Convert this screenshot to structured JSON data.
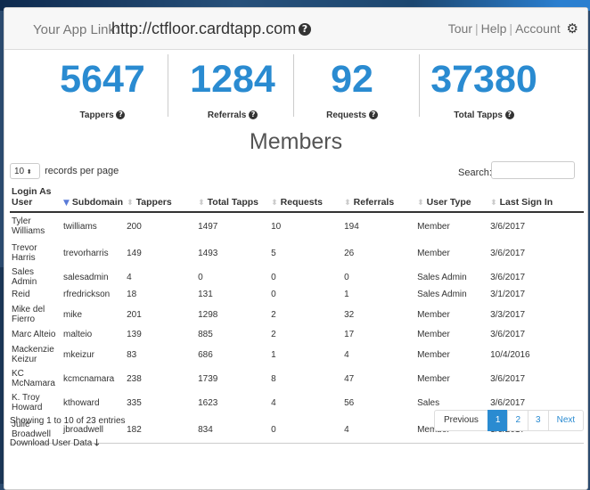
{
  "header": {
    "app_link_label": "Your App Link:",
    "app_link_url": "http://ctfloor.cardtapp.com",
    "nav": {
      "tour": "Tour",
      "help": "Help",
      "account": "Account"
    }
  },
  "stats": [
    {
      "value": "5647",
      "label": "Tappers"
    },
    {
      "value": "1284",
      "label": "Referrals"
    },
    {
      "value": "92",
      "label": "Requests"
    },
    {
      "value": "37380",
      "label": "Total Tapps"
    }
  ],
  "members_title": "Members",
  "controls": {
    "records_per_page_value": "10",
    "records_per_page_label": "records per page",
    "search_label": "Search:"
  },
  "table": {
    "columns": [
      "Login As User",
      "Subdomain",
      "Tappers",
      "Total Tapps",
      "Requests",
      "Referrals",
      "User Type",
      "Last Sign In"
    ],
    "rows": [
      [
        "Tyler Williams",
        "twilliams",
        "200",
        "1497",
        "10",
        "194",
        "Member",
        "3/6/2017"
      ],
      [
        "Trevor Harris",
        "trevorharris",
        "149",
        "1493",
        "5",
        "26",
        "Member",
        "3/6/2017"
      ],
      [
        "Sales Admin",
        "salesadmin",
        "4",
        "0",
        "0",
        "0",
        "Sales Admin",
        "3/6/2017"
      ],
      [
        "Reid",
        "rfredrickson",
        "18",
        "131",
        "0",
        "1",
        "Sales Admin",
        "3/1/2017"
      ],
      [
        "Mike del Fierro",
        "mike",
        "201",
        "1298",
        "2",
        "32",
        "Member",
        "3/3/2017"
      ],
      [
        "Marc Alteio",
        "malteio",
        "139",
        "885",
        "2",
        "17",
        "Member",
        "3/6/2017"
      ],
      [
        "Mackenzie Keizur",
        "mkeizur",
        "83",
        "686",
        "1",
        "4",
        "Member",
        "10/4/2016"
      ],
      [
        "KC McNamara",
        "kcmcnamara",
        "238",
        "1739",
        "8",
        "47",
        "Member",
        "3/6/2017"
      ],
      [
        "K. Troy Howard",
        "kthoward",
        "335",
        "1623",
        "4",
        "56",
        "Sales",
        "3/6/2017"
      ],
      [
        "Julie Broadwell",
        "jbroadwell",
        "182",
        "834",
        "0",
        "4",
        "Member",
        "3/6/2017"
      ]
    ]
  },
  "footer": {
    "showing": "Showing 1 to 10 of 23 entries",
    "pagination": {
      "previous": "Previous",
      "pages": [
        "1",
        "2",
        "3"
      ],
      "next": "Next"
    },
    "download": "Download User Data"
  },
  "colors": {
    "accent": "#2a8bd1"
  }
}
